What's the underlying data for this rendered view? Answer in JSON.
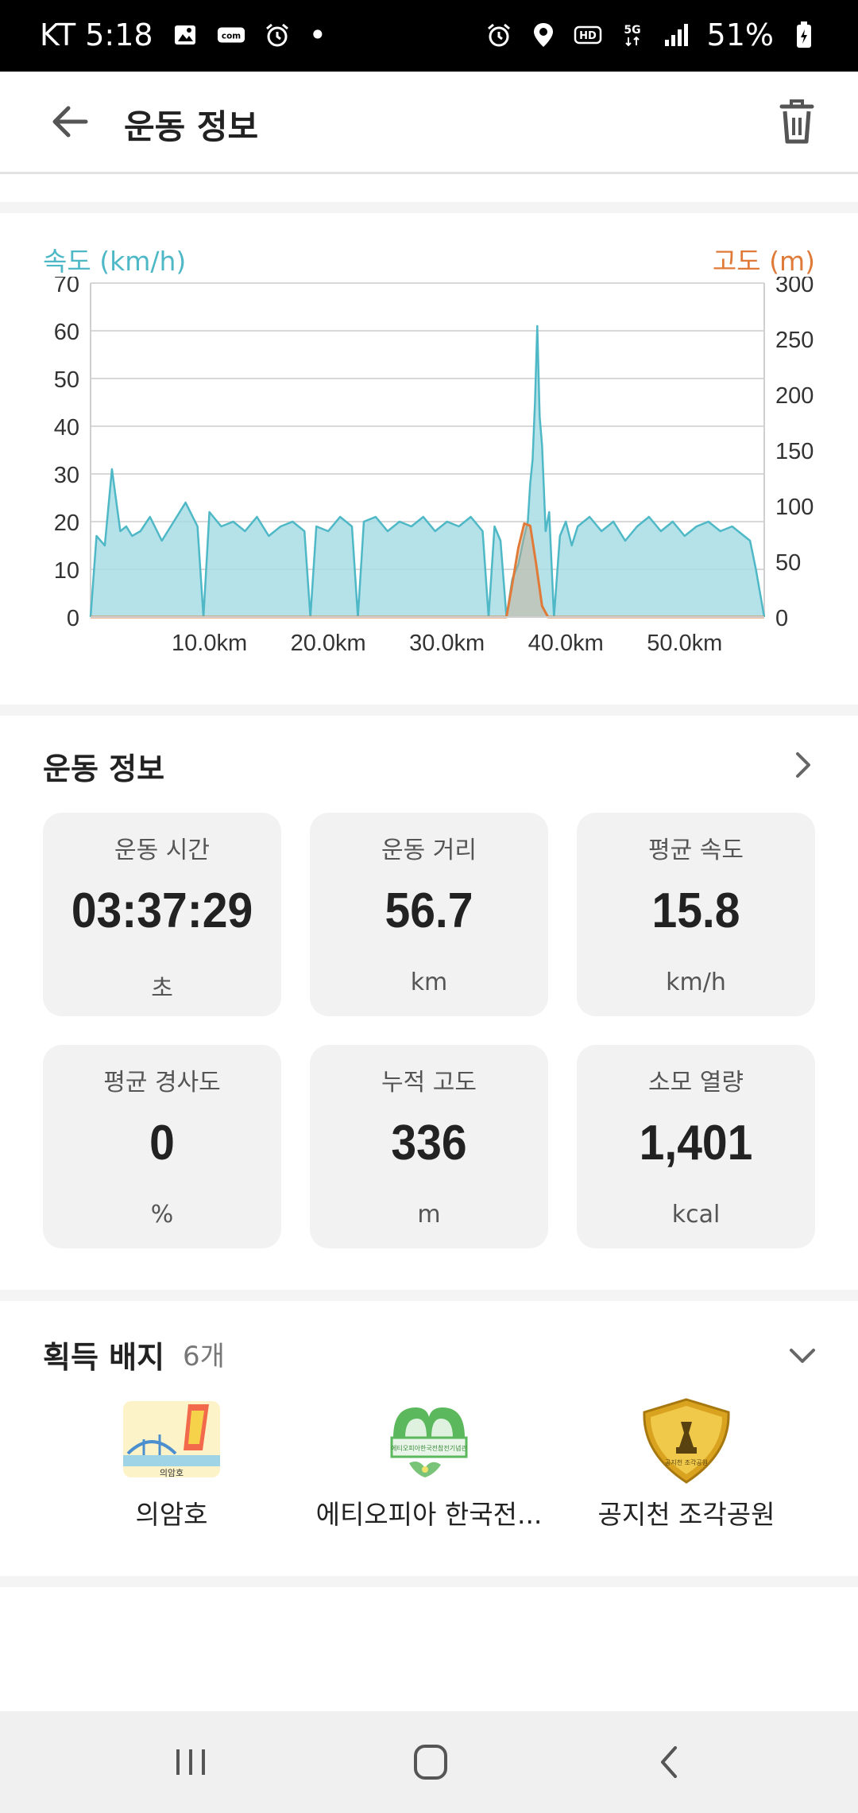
{
  "status_bar": {
    "carrier_time": "KT 5:18",
    "dot": "•",
    "battery": "51%",
    "icons_left": [
      "image-icon",
      "com-icon",
      "alarm-icon"
    ],
    "icons_right": [
      "alarm-icon",
      "location-icon",
      "hd-icon",
      "5g-icon",
      "signal-icon",
      "battery-icon"
    ]
  },
  "app_bar": {
    "title": "운동 정보"
  },
  "chart": {
    "speed_label": "속도 (km/h)",
    "altitude_label": "고도 (m)",
    "colors": {
      "speed": "#4fb8c6",
      "speed_fill": "#a8dde5",
      "altitude": "#e07a38"
    }
  },
  "chart_data": {
    "type": "area",
    "x_unit": "km",
    "x_range": [
      0,
      56.7
    ],
    "xticks": [
      "10.0km",
      "20.0km",
      "30.0km",
      "40.0km",
      "50.0km"
    ],
    "xtick_values": [
      10,
      20,
      30,
      40,
      50
    ],
    "left_axis": {
      "label": "속도 (km/h)",
      "ylim": [
        0,
        70
      ],
      "ticks": [
        0,
        10,
        20,
        30,
        40,
        50,
        60,
        70
      ]
    },
    "right_axis": {
      "label": "고도 (m)",
      "ylim": [
        0,
        300
      ],
      "ticks": [
        0,
        50,
        100,
        150,
        200,
        250,
        300
      ]
    },
    "grid": true,
    "series": [
      {
        "name": "속도 (km/h)",
        "axis": "left",
        "x": [
          0,
          0.5,
          1.2,
          1.8,
          2.5,
          3.0,
          3.5,
          4.2,
          5.0,
          6.0,
          7.0,
          8.0,
          9.0,
          9.5,
          10.0,
          11.0,
          12.0,
          13.0,
          14.0,
          15.0,
          16.0,
          17.0,
          18.0,
          18.5,
          19.0,
          20.0,
          21.0,
          22.0,
          22.5,
          23.0,
          24.0,
          25.0,
          26.0,
          27.0,
          28.0,
          29.0,
          30.0,
          31.0,
          32.0,
          33.0,
          33.5,
          34.0,
          34.5,
          35.0,
          35.5,
          36.0,
          36.5,
          36.8,
          37.0,
          37.2,
          37.4,
          37.6,
          37.8,
          38.0,
          38.3,
          38.6,
          39.0,
          39.5,
          40.0,
          40.5,
          41.0,
          42.0,
          43.0,
          44.0,
          45.0,
          46.0,
          47.0,
          48.0,
          49.0,
          50.0,
          51.0,
          52.0,
          53.0,
          54.0,
          55.0,
          55.5,
          56.0,
          56.7
        ],
        "values": [
          0,
          17,
          15,
          31,
          18,
          19,
          17,
          18,
          21,
          16,
          20,
          24,
          19,
          0,
          22,
          19,
          20,
          18,
          21,
          17,
          19,
          20,
          18,
          0,
          19,
          18,
          21,
          19,
          0,
          20,
          21,
          18,
          20,
          19,
          21,
          18,
          20,
          19,
          21,
          18,
          0,
          19,
          16,
          0,
          8,
          11,
          17,
          20,
          28,
          33,
          45,
          61,
          42,
          36,
          18,
          22,
          0,
          17,
          20,
          15,
          19,
          21,
          18,
          20,
          16,
          19,
          21,
          18,
          20,
          17,
          19,
          20,
          18,
          19,
          17,
          16,
          10,
          0
        ]
      },
      {
        "name": "고도 (m)",
        "axis": "right",
        "x": [
          0,
          34.5,
          35.0,
          35.5,
          36.0,
          36.5,
          37.0,
          37.5,
          38.0,
          38.5,
          56.7
        ],
        "values": [
          0,
          0,
          0,
          30,
          62,
          84,
          82,
          48,
          10,
          0,
          0
        ]
      }
    ]
  },
  "workout_info": {
    "section_title": "운동 정보",
    "tiles": [
      {
        "label": "운동 시간",
        "value": "03:37:29",
        "unit": "초"
      },
      {
        "label": "운동 거리",
        "value": "56.7",
        "unit": "km"
      },
      {
        "label": "평균 속도",
        "value": "15.8",
        "unit": "km/h"
      },
      {
        "label": "평균 경사도",
        "value": "0",
        "unit": "%"
      },
      {
        "label": "누적 고도",
        "value": "336",
        "unit": "m"
      },
      {
        "label": "소모 열량",
        "value": "1,401",
        "unit": "kcal"
      }
    ]
  },
  "badges": {
    "section_title": "획득 배지",
    "count": "6개",
    "items": [
      {
        "name": "의암호",
        "icon": "sailboat-badge-icon",
        "caption": "의암호"
      },
      {
        "name": "에티오피아 한국전...",
        "icon": "memorial-hall-badge-icon",
        "caption": "에티오피아한국전참전기념관"
      },
      {
        "name": "공지천 조각공원",
        "icon": "sculpture-park-badge-icon",
        "caption": "공지천 조각공원"
      }
    ]
  },
  "nav_bar": {
    "buttons": [
      "recent-apps-icon",
      "home-icon",
      "back-icon"
    ]
  }
}
